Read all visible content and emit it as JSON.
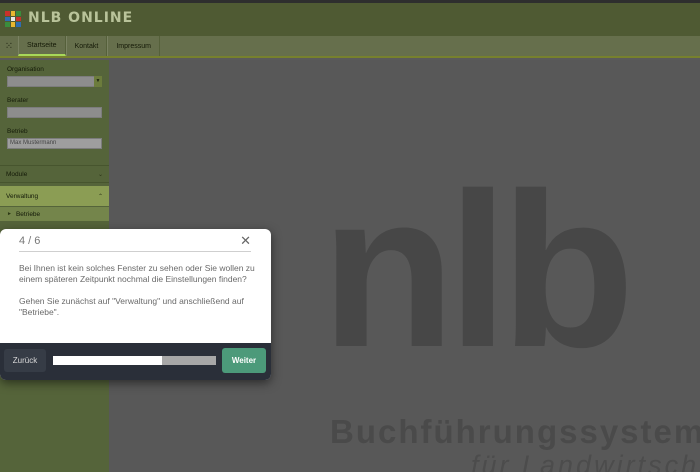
{
  "app": {
    "title": "NLB ONLINE",
    "logo_colors": [
      "#c8322b",
      "#e8b72f",
      "#3a8d3c",
      "#2f6db2",
      "#e8e8e8",
      "#c8322b",
      "#3a8d3c",
      "#e8b72f",
      "#2f6db2"
    ]
  },
  "nav": {
    "tabs": [
      {
        "label": "Startseite"
      },
      {
        "label": "Kontakt"
      },
      {
        "label": "Impressum"
      }
    ]
  },
  "sidebar": {
    "organisation_label": "Organisation",
    "berater_label": "Berater",
    "betrieb_label": "Betrieb",
    "betrieb_value": "Max Mustermann",
    "module_label": "Module",
    "verwaltung_label": "Verwaltung",
    "betriebe_label": "Betriebe"
  },
  "content": {
    "logo_text": "nlb",
    "tagline1": "Buchführungssystem",
    "tagline2": "für Landwirtsch"
  },
  "dialog": {
    "step": "4 / 6",
    "paragraph1": "Bei Ihnen ist kein solches Fenster zu sehen oder Sie wollen zu einem späteren Zeitpunkt nochmal die Einstellungen finden?",
    "paragraph2": "Gehen Sie zunächst auf \"Verwaltung\" und anschließend auf \"Betriebe\".",
    "back_label": "Zurück",
    "next_label": "Weiter",
    "progress": 0.67,
    "accent": "#4c9a7a"
  }
}
